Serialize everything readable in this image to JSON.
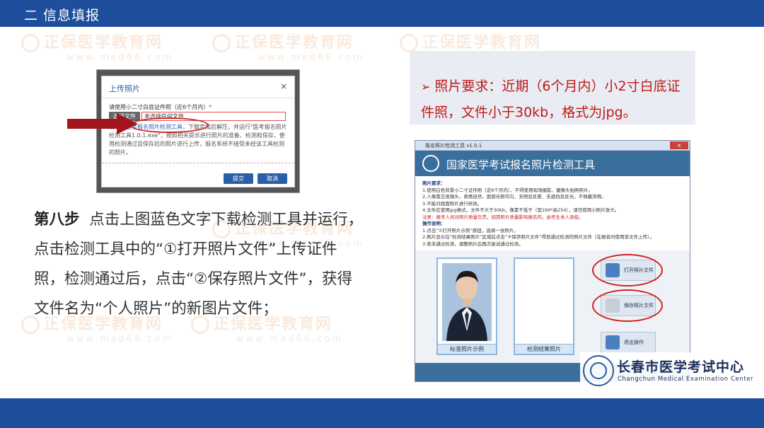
{
  "header": {
    "title": "二 信息填报"
  },
  "watermark": {
    "brand": "正保医学教育网",
    "url": "www.med66.com"
  },
  "upload_dialog": {
    "title": "上传照片",
    "close": "×",
    "field_label": "请使用小二寸白底证件照（近6个月内）",
    "required_mark": "*",
    "file_button": "选择文件",
    "file_value": "未选择任何文件",
    "desc_prefix": "请下载",
    "desc_link": "医考报名照片检测工具",
    "desc_rest": "，下载完成后解压，并运行\"医考报名照片检测工具1.0.1.exe\"，按照相关提示进行照片的准备、检测和保存，使用检测通过且保存后的照片进行上传，报名系统不接受未经该工具检测的照片。",
    "submit_label": "提交",
    "cancel_label": "取消"
  },
  "step": {
    "number": "第八步",
    "text": "点击上图蓝色文字下载检测工具并运行，点击检测工具中的“①打开照片文件”上传证件照，检测通过后，点击“②保存照片文件”，获得文件名为“个人照片”的新图片文件；"
  },
  "requirement": {
    "arrow": "➢",
    "text": "照片要求：近期（6个月内）小2寸白底证件照，文件小于30kb，格式为jpg。"
  },
  "tool": {
    "window_title": "报名照片检测工具 v1.0.1",
    "close": "×",
    "app_name": "国家医学考试报名照片检测工具",
    "req_head": "照片要求：",
    "req_lines": [
      "1.使用白色背景小二寸证件照（近6个月内），不得使用现场摄影、摄像头拍照照片。",
      "2.人像需正视镜头，表情自然，面部光照均匀，无明显反差、无遮挡及反光，不佩戴饰物。",
      "3.不能对画面照片进行修改。",
      "4.文件应使用jpg格式，文件不大于30kb，像素不低于（宽190*高254），请勿使用小照片放大。"
    ],
    "req_warn": "注意：报考人员对照片质量负责，如因照片质量影响报名的，由考生本人承担。",
    "op_head": "操作说明：",
    "op_lines": [
      "1.点击“①打开照片示例”按钮，选择一张照片。",
      "2.照片显示在“检测结果照片”区域后点击“②保存照片文件”得到通过检测的照片文件（在报名时使用该文件上传）。",
      "3.若未通过检测，调整照片后再次尝试通过检测。"
    ],
    "caption_sample": "标准照片示例",
    "caption_result": "检测结果照片",
    "open_button": "打开照片文件",
    "save_button": "保存照片文件",
    "exit_button": "退出操作"
  },
  "center_logo": {
    "name_cn": "长春市医学考试中心",
    "name_en": "Changchun Medical Examination Center"
  },
  "colors": {
    "brand_blue": "#1f4f9c",
    "requirement_red": "#c01818",
    "highlight_red": "#d42020"
  }
}
